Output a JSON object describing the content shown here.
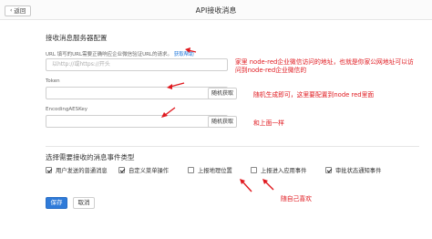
{
  "header": {
    "back_label": "返回",
    "title": "API接收消息"
  },
  "server_config": {
    "section_title": "接收消息服务器配置",
    "url": {
      "label": "URL  填写的URL需要正确响应企业微信验证URL的请求。",
      "link": "获取帮助",
      "placeholder": "以http://或https://开头"
    },
    "token": {
      "label": "Token",
      "value": "",
      "random_button": "随机获取"
    },
    "aeskey": {
      "label": "EncodingAESKey",
      "value": "",
      "random_button": "随机获取"
    }
  },
  "annotations": {
    "url_note_line1": "家里 node-red企业微信访问的地址，也就是你家公网地址可以访",
    "url_note_line2": "问到node-red企业微信的",
    "token_note": "随机生成即可，这里要配置到node red里面",
    "aes_note": "和上面一样",
    "events_note": "随自己喜欢"
  },
  "events": {
    "section_title": "选择需要接收的消息事件类型",
    "items": [
      {
        "label": "用户发送的普通消息",
        "checked": true
      },
      {
        "label": "自定义菜单操作",
        "checked": true
      },
      {
        "label": "上报地理位置",
        "checked": false
      },
      {
        "label": "上报进入应用事件",
        "checked": false
      },
      {
        "label": "审批状态通知事件",
        "checked": true
      }
    ]
  },
  "footer": {
    "save_label": "保存",
    "cancel_label": "取消"
  },
  "colors": {
    "accent": "#2f7bd9",
    "annotation": "#e0191f"
  }
}
